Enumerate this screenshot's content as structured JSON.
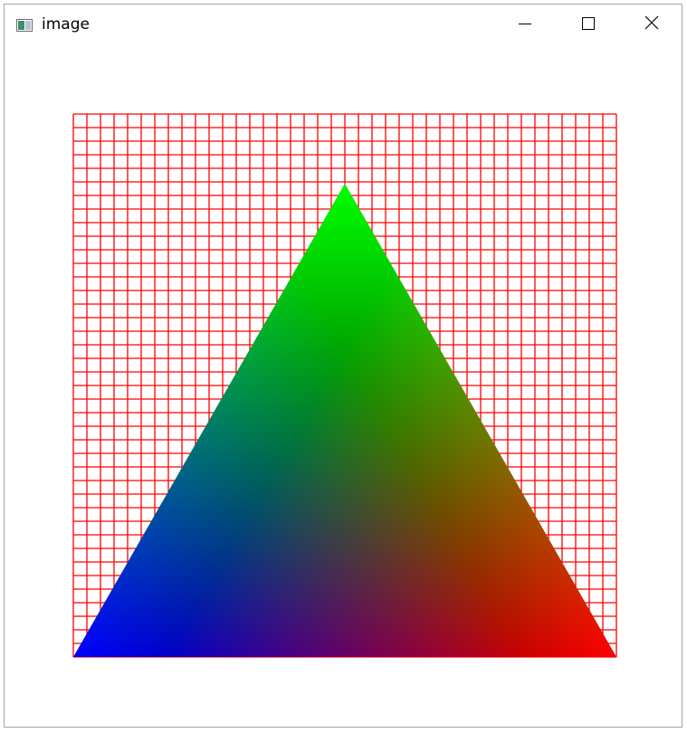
{
  "window": {
    "title": "image",
    "icons": {
      "app": "app-image-icon",
      "minimize": "minimize-icon",
      "maximize": "maximize-icon",
      "close": "close-icon"
    }
  },
  "canvas": {
    "grid_color": "#ff0000",
    "grid_columns": 40,
    "grid_rows": 40,
    "triangle": {
      "vertex_colors": {
        "top": "#00ff00",
        "bottom_left": "#0000ff",
        "bottom_right": "#ff0000"
      }
    }
  }
}
